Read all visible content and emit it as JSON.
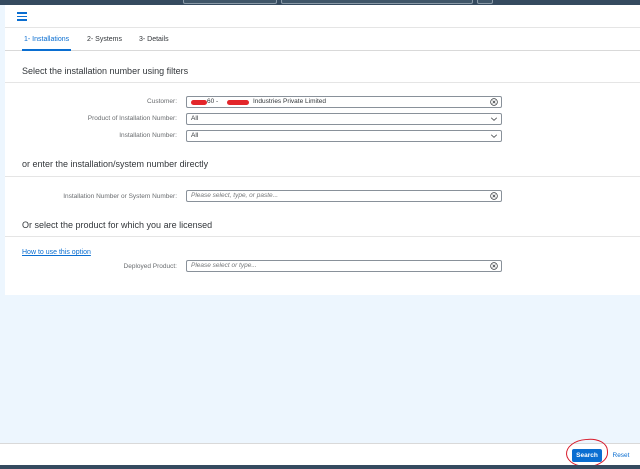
{
  "tabs": [
    {
      "label": "1- Installations",
      "active": true
    },
    {
      "label": "2- Systems",
      "active": false
    },
    {
      "label": "3- Details",
      "active": false
    }
  ],
  "sections": {
    "filters_title": "Select the installation number using filters",
    "direct_title": "or enter the installation/system number directly",
    "product_title": "Or select the product for which you are licensed"
  },
  "filters": {
    "customer": {
      "label": "Customer:",
      "value": "**60 - ***** Industries Private Limited",
      "value_visible": "60 -",
      "value_rest": "Industries Private Limited"
    },
    "product_of_installation": {
      "label": "Product of Installation Number:",
      "value": "All"
    },
    "installation_number": {
      "label": "Installation Number:",
      "value": "All"
    }
  },
  "direct": {
    "label": "Installation Number or System Number:",
    "placeholder": "Please select, type, or paste..."
  },
  "product": {
    "how_to_link": "How to use this option",
    "label": "Deployed Product:",
    "placeholder": "Please select or type..."
  },
  "footer": {
    "search_label": "Search",
    "reset_label": "Reset"
  },
  "colors": {
    "accent": "#0a6ed1",
    "annotation": "#d81b2b",
    "page_background": "#edf6fe"
  }
}
